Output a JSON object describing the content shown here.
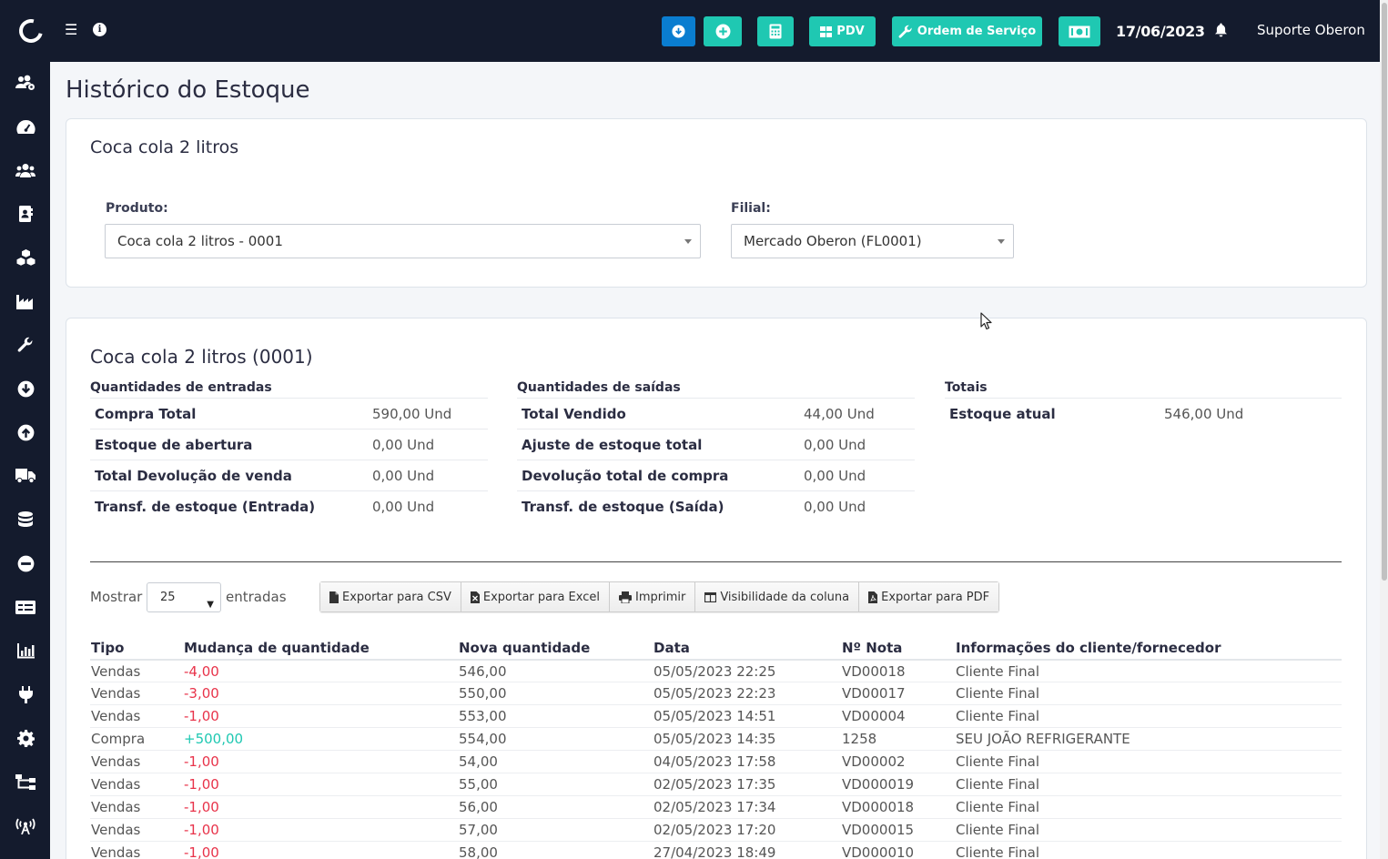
{
  "header": {
    "pdv_label": "PDV",
    "os_label": "Ordem de Serviço",
    "date": "17/06/2023",
    "user": "Suporte Oberon",
    "colors": {
      "topbar": "#141b2d",
      "blue_btn": "#0a7dd0",
      "teal_btn": "#1fc8b2"
    }
  },
  "sidebar": {
    "icons": [
      "users-cog-icon",
      "tachometer-icon",
      "users-icon",
      "address-book-icon",
      "cubes-icon",
      "industry-icon",
      "wrench-icon",
      "arrow-circle-down-icon",
      "arrow-circle-up-icon",
      "truck-icon",
      "database-icon",
      "minus-circle-icon",
      "money-check-icon",
      "chart-bar-icon",
      "plug-icon",
      "cog-icon",
      "sitemap-icon",
      "broadcast-tower-icon"
    ]
  },
  "page": {
    "title": "Histórico do Estoque"
  },
  "filter_card": {
    "title": "Coca cola 2 litros",
    "product_label": "Produto:",
    "product_value": "Coca cola 2 litros - 0001",
    "branch_label": "Filial:",
    "branch_value": "Mercado Oberon (FL0001)"
  },
  "summary": {
    "title": "Coca cola 2 litros (0001)",
    "entradas": {
      "heading": "Quantidades de entradas",
      "rows": [
        {
          "label": "Compra Total",
          "value": "590,00 Und"
        },
        {
          "label": "Estoque de abertura",
          "value": "0,00 Und"
        },
        {
          "label": "Total Devolução de venda",
          "value": "0,00 Und"
        },
        {
          "label": "Transf. de estoque (Entrada)",
          "value": "0,00 Und"
        }
      ]
    },
    "saidas": {
      "heading": "Quantidades de saídas",
      "rows": [
        {
          "label": "Total Vendido",
          "value": "44,00 Und"
        },
        {
          "label": "Ajuste de estoque total",
          "value": "0,00 Und"
        },
        {
          "label": "Devolução total de compra",
          "value": "0,00 Und"
        },
        {
          "label": "Transf. de estoque (Saída)",
          "value": "0,00 Und"
        }
      ]
    },
    "totais": {
      "heading": "Totais",
      "rows": [
        {
          "label": "Estoque atual",
          "value": "546,00 Und"
        }
      ]
    }
  },
  "table_controls": {
    "show_label": "Mostrar",
    "page_length": "25",
    "entries_label": "entradas",
    "buttons": {
      "csv": "Exportar para CSV",
      "excel": "Exportar para Excel",
      "print": "Imprimir",
      "colvis": "Visibilidade da coluna",
      "pdf": "Exportar para PDF"
    }
  },
  "history_table": {
    "headers": [
      "Tipo",
      "Mudança de quantidade",
      "Nova quantidade",
      "Data",
      "Nº Nota",
      "Informações do cliente/fornecedor"
    ],
    "rows": [
      {
        "tipo": "Vendas",
        "mudanca": "-4,00",
        "nova": "546,00",
        "data": "05/05/2023 22:25",
        "nota": "VD00018",
        "info": "Cliente Final"
      },
      {
        "tipo": "Vendas",
        "mudanca": "-3,00",
        "nova": "550,00",
        "data": "05/05/2023 22:23",
        "nota": "VD00017",
        "info": "Cliente Final"
      },
      {
        "tipo": "Vendas",
        "mudanca": "-1,00",
        "nova": "553,00",
        "data": "05/05/2023 14:51",
        "nota": "VD00004",
        "info": "Cliente Final"
      },
      {
        "tipo": "Compra",
        "mudanca": "+500,00",
        "nova": "554,00",
        "data": "05/05/2023 14:35",
        "nota": "1258",
        "info": "SEU JOÃO REFRIGERANTE"
      },
      {
        "tipo": "Vendas",
        "mudanca": "-1,00",
        "nova": "54,00",
        "data": "04/05/2023 17:58",
        "nota": "VD00002",
        "info": "Cliente Final"
      },
      {
        "tipo": "Vendas",
        "mudanca": "-1,00",
        "nova": "55,00",
        "data": "02/05/2023 17:35",
        "nota": "VD000019",
        "info": "Cliente Final"
      },
      {
        "tipo": "Vendas",
        "mudanca": "-1,00",
        "nova": "56,00",
        "data": "02/05/2023 17:34",
        "nota": "VD000018",
        "info": "Cliente Final"
      },
      {
        "tipo": "Vendas",
        "mudanca": "-1,00",
        "nova": "57,00",
        "data": "02/05/2023 17:20",
        "nota": "VD000015",
        "info": "Cliente Final"
      },
      {
        "tipo": "Vendas",
        "mudanca": "-1,00",
        "nova": "58,00",
        "data": "27/04/2023 18:49",
        "nota": "VD000010",
        "info": "Cliente Final"
      }
    ]
  }
}
